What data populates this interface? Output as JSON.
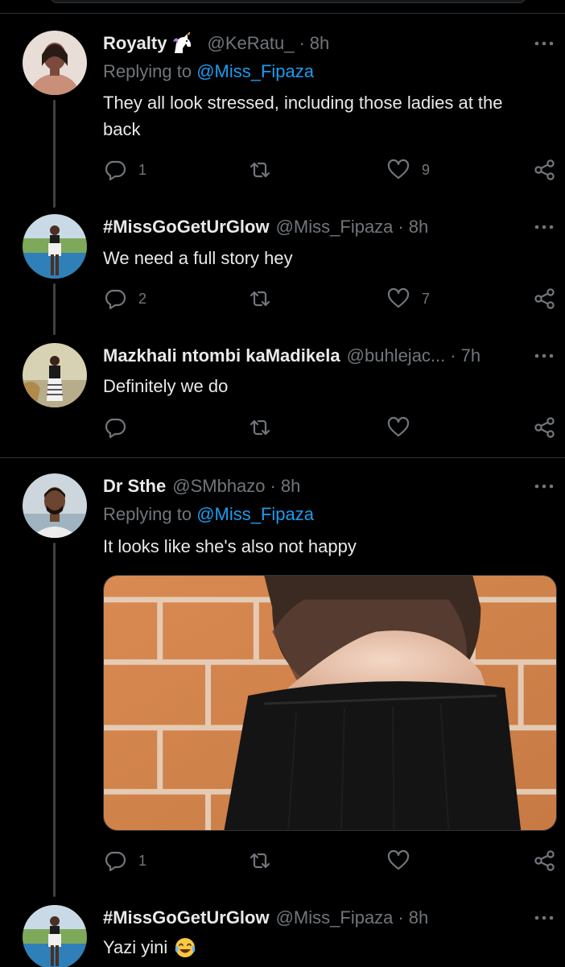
{
  "tweets": [
    {
      "name": "Royalty",
      "name_emoji": "unicorn-emoji",
      "handle": "@KeRatu_",
      "separator": "·",
      "time": "8h",
      "replying_prefix": "Replying to",
      "replying_to": "@Miss_Fipaza",
      "text_lines": [
        "They all look stressed, including those ladies at the",
        "back"
      ],
      "replies": "1",
      "retweets": "",
      "likes": "9"
    },
    {
      "name": "#MissGoGetUrGlow",
      "handle": "@Miss_Fipaza",
      "separator": "·",
      "time": "8h",
      "text": "We need a full story hey",
      "replies": "2",
      "retweets": "",
      "likes": "7"
    },
    {
      "name": "Mazkhali ntombi kaMadikela",
      "handle": "@buhlejac...",
      "separator": "·",
      "time": "7h",
      "text": "Definitely we do",
      "replies": "",
      "retweets": "",
      "likes": ""
    },
    {
      "name": "Dr Sthe",
      "handle": "@SMbhazo",
      "separator": "·",
      "time": "8h",
      "replying_prefix": "Replying to",
      "replying_to": "@Miss_Fipaza",
      "text": "It looks like she's also not happy",
      "media": "photo-brick-wall-black-top",
      "replies": "1",
      "retweets": "",
      "likes": ""
    },
    {
      "name": "#MissGoGetUrGlow",
      "handle": "@Miss_Fipaza",
      "separator": "·",
      "time": "8h",
      "text": "Yazi yini",
      "text_emoji": "face-with-tears-of-joy-emoji"
    }
  ],
  "icons": {
    "reply": "reply-icon",
    "retweet": "retweet-icon",
    "like": "heart-icon",
    "share": "share-icon",
    "more": "more-dots-icon"
  },
  "colors": {
    "background": "#000000",
    "text": "#e7e9ea",
    "muted": "#71767b",
    "link": "#1d9bf0",
    "divider": "#2f3336",
    "thread_line": "#3e4144"
  }
}
